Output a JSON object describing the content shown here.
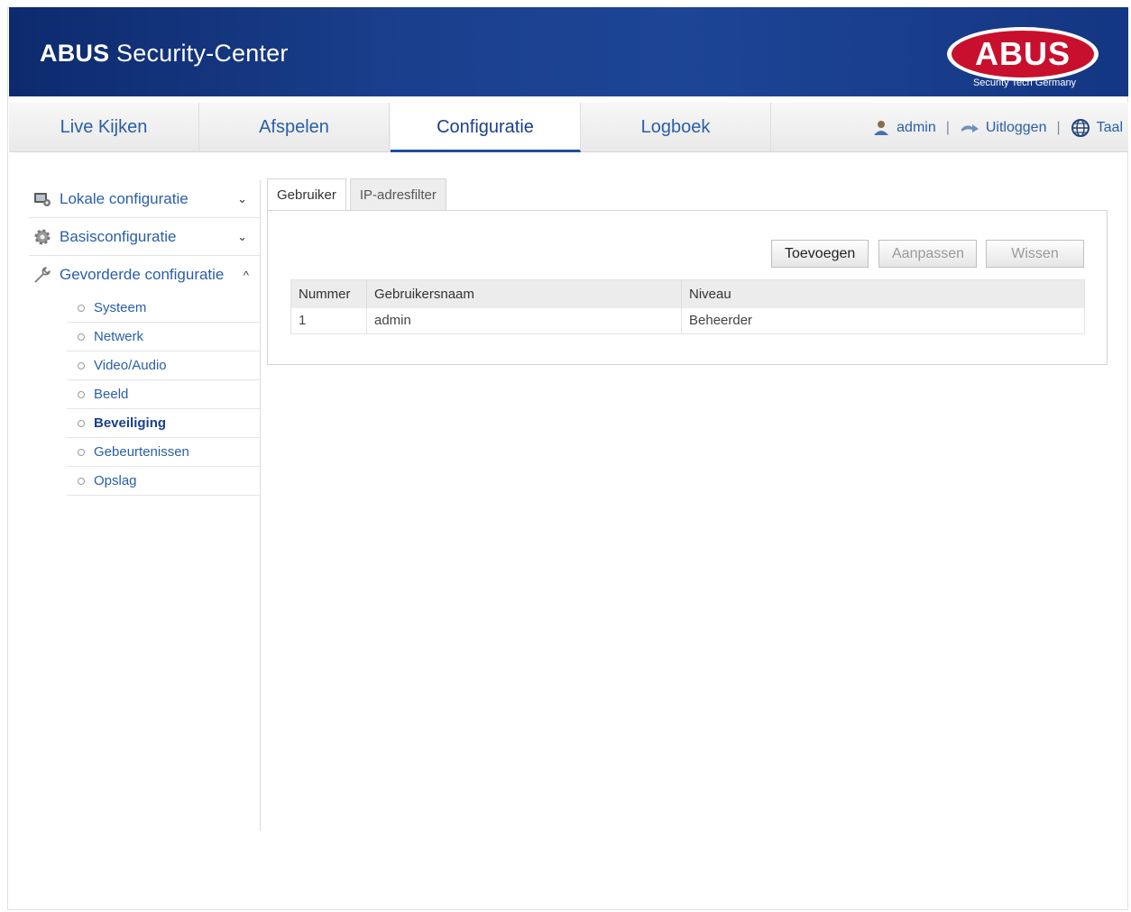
{
  "header": {
    "brand": "ABUS",
    "app_title_rest": " Security-Center",
    "logo_text": "ABUS",
    "logo_tagline": "Security Tech Germany",
    "colors": {
      "header_blue": "#1a3f8c",
      "logo_red": "#c8102e"
    }
  },
  "topnav": {
    "tabs": [
      {
        "label": "Live Kijken"
      },
      {
        "label": "Afspelen"
      },
      {
        "label": "Configuratie",
        "active": true
      },
      {
        "label": "Logboek"
      }
    ],
    "user": "admin",
    "logout": "Uitloggen",
    "language": "Taal",
    "separator": "|",
    "icons": [
      "user-icon",
      "logout-icon",
      "globe-icon"
    ]
  },
  "sidebar": {
    "groups": [
      {
        "label": "Lokale configuratie",
        "icon": "monitor-gear-icon",
        "chevron": "⌄",
        "open": false
      },
      {
        "label": "Basisconfiguratie",
        "icon": "gear-icon",
        "chevron": "⌄",
        "open": false
      },
      {
        "label": "Gevorderde configuratie",
        "icon": "wrench-icon",
        "chevron": "^",
        "open": true
      }
    ],
    "sub_items": [
      {
        "label": "Systeem"
      },
      {
        "label": "Netwerk"
      },
      {
        "label": "Video/Audio"
      },
      {
        "label": "Beeld"
      },
      {
        "label": "Beveiliging",
        "active": true
      },
      {
        "label": "Gebeurtenissen"
      },
      {
        "label": "Opslag"
      }
    ]
  },
  "content": {
    "tabs": [
      {
        "label": "Gebruiker",
        "active": true
      },
      {
        "label": "IP-adresfilter"
      }
    ],
    "buttons": {
      "add": "Toevoegen",
      "edit": "Aanpassen",
      "delete": "Wissen"
    },
    "table": {
      "headers": [
        "Nummer",
        "Gebruikersnaam",
        "Niveau"
      ],
      "rows": [
        [
          "1",
          "admin",
          "Beheerder"
        ]
      ]
    }
  }
}
